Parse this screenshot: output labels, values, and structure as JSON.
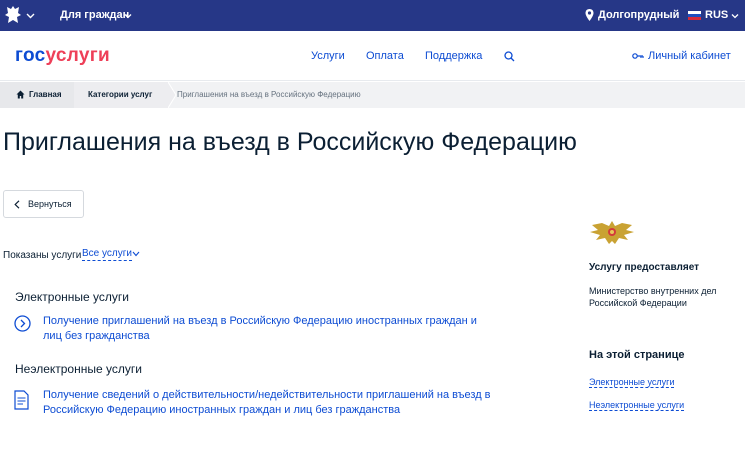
{
  "topbar": {
    "audience": "Для граждан",
    "location": "Долгопрудный",
    "language": "RUS"
  },
  "header": {
    "logo_part1": "гос",
    "logo_part2": "услуги",
    "nav": [
      "Услуги",
      "Оплата",
      "Поддержка"
    ],
    "cabinet": "Личный кабинет"
  },
  "breadcrumb": [
    "Главная",
    "Категории услуг",
    "Приглашения на въезд в Российскую Федерацию"
  ],
  "page": {
    "title": "Приглашения на въезд в Российскую Федерацию",
    "back_label": "Вернуться",
    "shown_label": "Показаны услуги",
    "shown_value": "Все услуги"
  },
  "sections": [
    {
      "heading": "Электронные услуги",
      "service": "Получение приглашений на въезд в Российскую Федерацию иностранных граждан и лиц без гражданства"
    },
    {
      "heading": "Неэлектронные услуги",
      "service": "Получение сведений о действительности/недействительности приглашений на въезд в Российскую Федерацию иностранных граждан и лиц без гражданства"
    }
  ],
  "sidebar": {
    "provider_heading": "Услугу предоставляет",
    "provider_name": "Министерство внутренних дел Российской Федерации",
    "on_page_heading": "На этой странице",
    "links": [
      "Электронные услуги",
      "Неэлектронные услуги"
    ]
  },
  "colors": {
    "topbar": "#263787",
    "link": "#0d4cd3",
    "logo_red": "#ee3f58"
  }
}
